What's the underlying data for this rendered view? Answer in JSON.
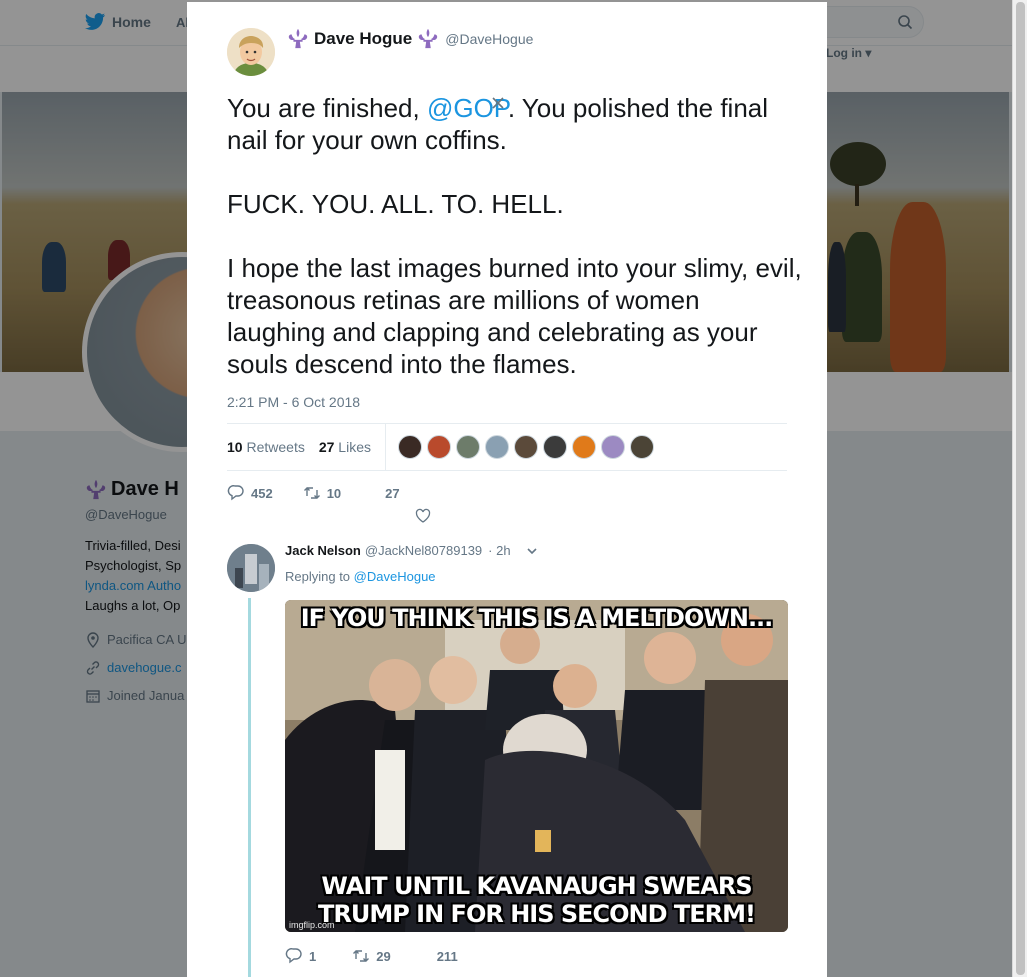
{
  "background": {
    "nav": {
      "home_label": "Home",
      "about_label_partial": "Al"
    },
    "login_label": "Log in",
    "bio": {
      "name_partial": "Dave H",
      "handle": "@DaveHogue",
      "desc_lines": [
        "Trivia-filled, Desi",
        "Psychologist, Sp",
        "lynda.com Autho",
        "Laughs a lot, Op"
      ],
      "location_partial": "Pacifica CA U",
      "website_partial": "davehogue.c",
      "joined_partial": "Joined Janua"
    }
  },
  "tweet": {
    "display_name": "Dave Hogue",
    "screen_name": "@DaveHogue",
    "text": {
      "line1_pre": "You are finished, ",
      "line1_mention": "@GOP",
      "line1_post": ". You polished the final nail for your own coffins.",
      "para2": "FUCK. YOU. ALL. TO. HELL.",
      "para3": "I hope the last images burned into your slimy, evil, treasonous retinas are millions of women laughing and clapping and celebrating as your souls descend into the flames."
    },
    "timestamp": "2:21 PM - 6 Oct 2018",
    "retweets_count": "10",
    "retweets_label": "Retweets",
    "likes_count": "27",
    "likes_label": "Likes",
    "face_colors": [
      "#3a2a24",
      "#b94a2c",
      "#6d7c6a",
      "#8aa0b2",
      "#5b4a3a",
      "#3b3b3b",
      "#e07a1a",
      "#9c8ac2",
      "#4b4436"
    ],
    "actions": {
      "replies": "452",
      "retweets": "10",
      "likes": "27"
    }
  },
  "reply": {
    "name": "Jack Nelson",
    "handle": "@JackNel80789139",
    "time": "· 2h",
    "replying_to_label": "Replying to",
    "replying_to_handle": "@DaveHogue",
    "meme_top": "IF YOU THINK THIS IS A MELTDOWN...",
    "meme_bottom_1": "WAIT UNTIL KAVANAUGH SWEARS",
    "meme_bottom_2": "TRUMP IN FOR HIS SECOND TERM!",
    "meme_watermark": "imgflip.com",
    "actions": {
      "replies": "1",
      "retweets": "29",
      "likes": "211"
    }
  },
  "colors": {
    "link": "#1b95e0",
    "muted": "#657786",
    "thread": "#a4d9df",
    "fleur": "#8e6bbf"
  }
}
